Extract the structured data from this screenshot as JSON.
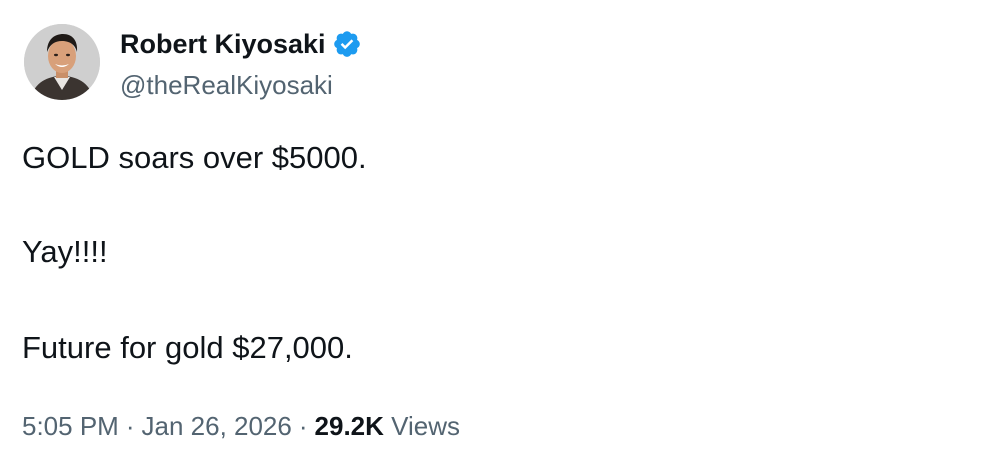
{
  "tweet": {
    "author": {
      "display_name": "Robert Kiyosaki",
      "handle": "@theRealKiyosaki",
      "verified": true,
      "verified_color": "#1d9bf0",
      "avatar_icon": "profile-photo"
    },
    "text_lines": [
      "GOLD soars over $5000.",
      "Yay!!!!",
      "Future for gold $27,000."
    ],
    "meta": {
      "time": "5:05 PM",
      "separator": "·",
      "date": "Jan 26, 2026",
      "views_count": "29.2K",
      "views_label": "Views"
    }
  },
  "colors": {
    "primary_text": "#0f1419",
    "secondary_text": "#536471",
    "background": "#ffffff"
  }
}
